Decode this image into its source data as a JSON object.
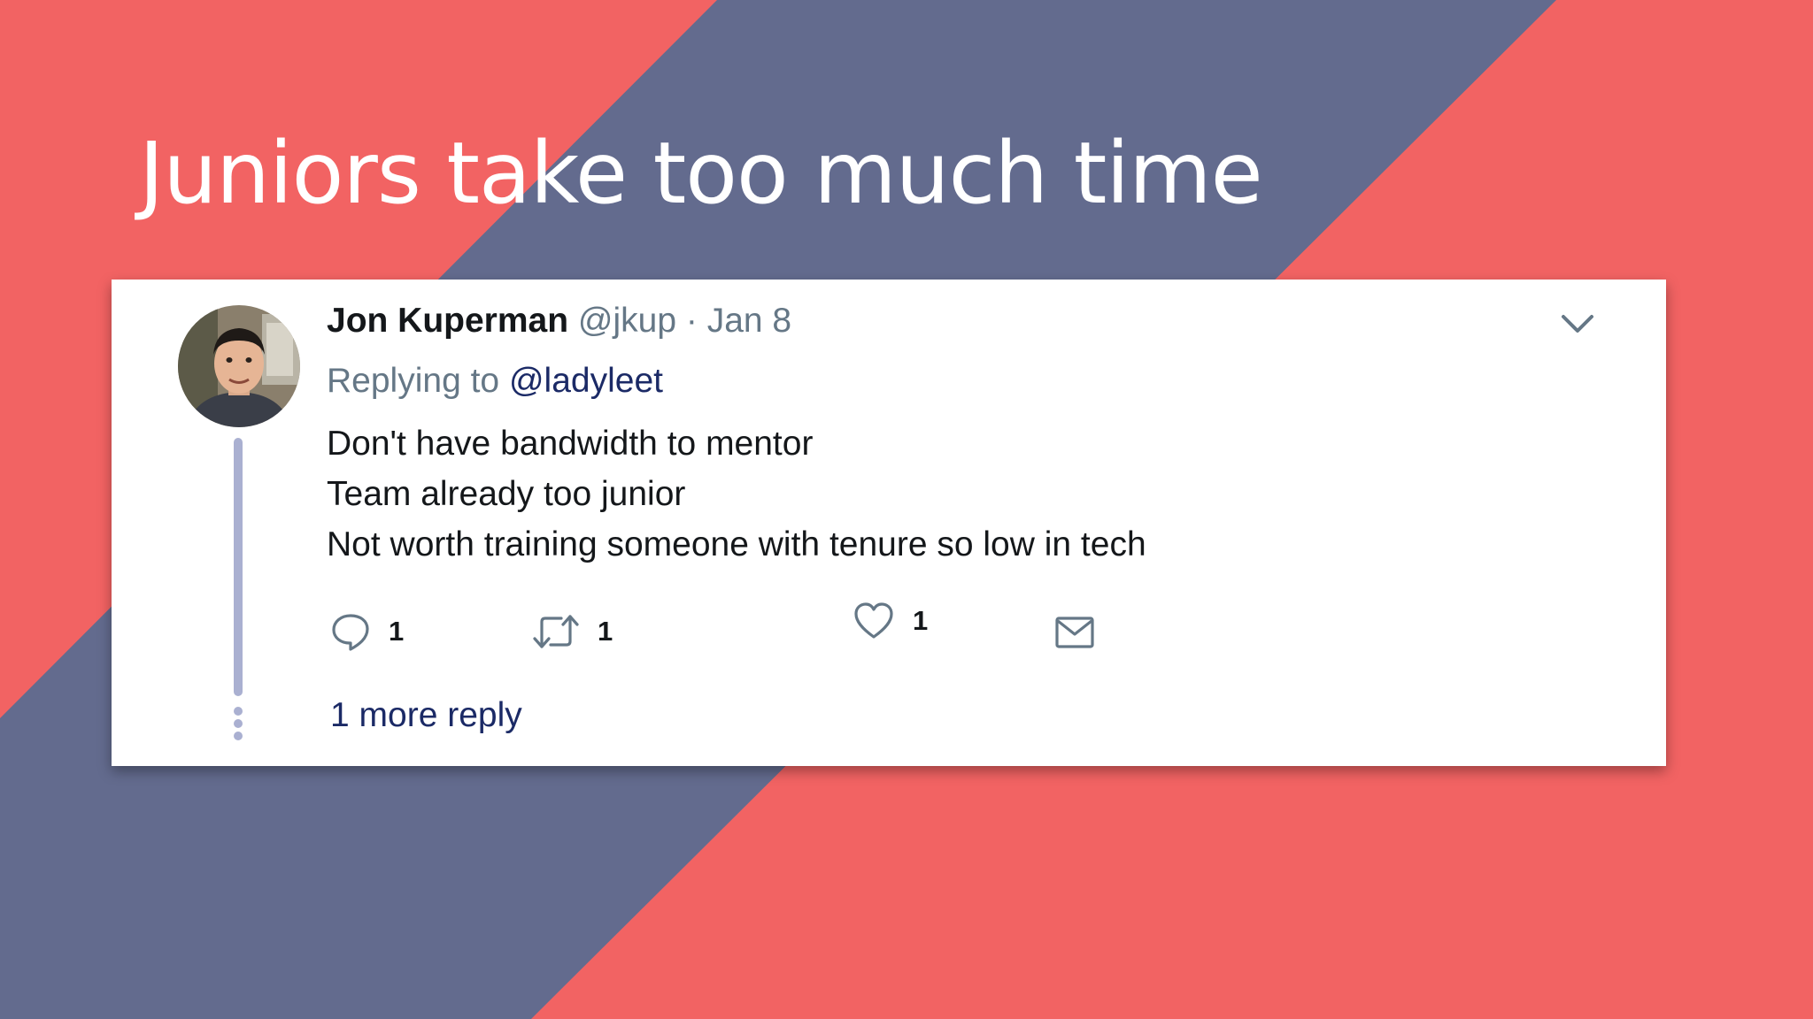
{
  "slide": {
    "title": "Juniors take too much time",
    "colors": {
      "background_red": "#f26363",
      "stripe_blue": "#636b8e",
      "white": "#ffffff"
    }
  },
  "tweet": {
    "author_name": "Jon Kuperman",
    "author_handle": "@jkup",
    "separator": "·",
    "date": "Jan 8",
    "reply_prefix": "Replying to",
    "reply_to_handle": "@ladyleet",
    "body_lines": [
      "Don't have bandwidth to mentor",
      "Team already too junior",
      "Not worth training someone with tenure so low in tech"
    ],
    "actions": {
      "reply": {
        "icon": "speech-bubble-icon",
        "count": "1"
      },
      "retweet": {
        "icon": "retweet-icon",
        "count": "1"
      },
      "like": {
        "icon": "heart-icon",
        "count": "1"
      },
      "message": {
        "icon": "envelope-icon"
      }
    },
    "more_replies_label": "1 more reply",
    "menu_icon": "chevron-down-icon",
    "colors": {
      "name": "#14171a",
      "muted": "#657786",
      "link": "#1b2a66",
      "thread_line": "#aab0d1"
    }
  }
}
